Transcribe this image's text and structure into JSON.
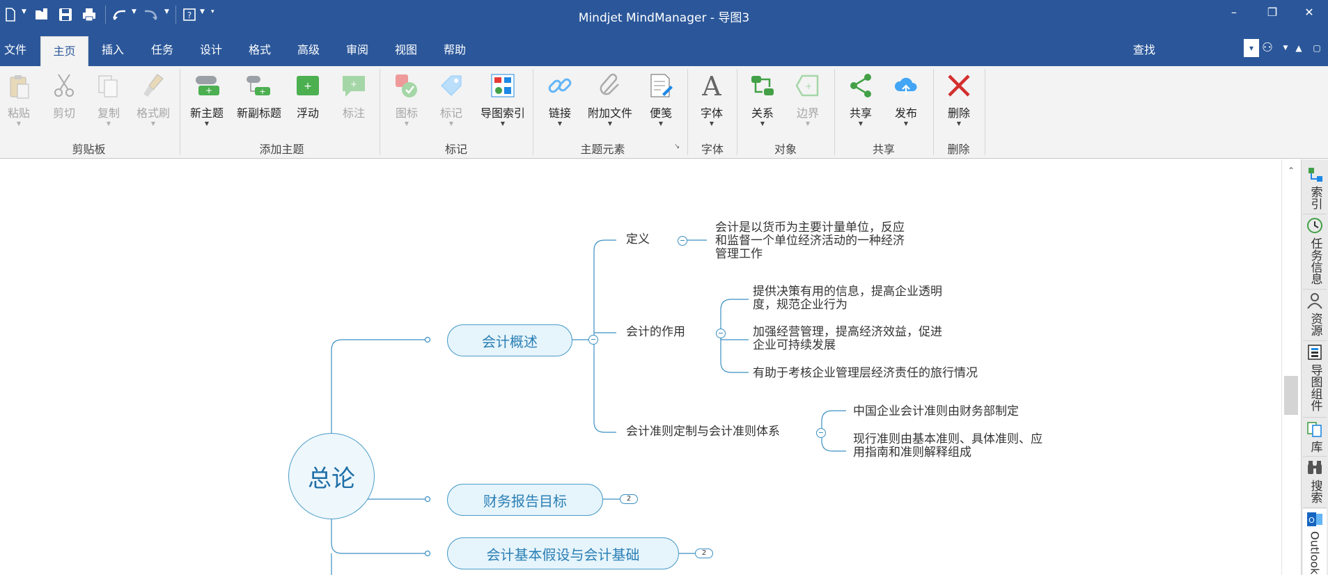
{
  "window": {
    "title": "Mindjet MindManager - 导图3",
    "controls": {
      "minimize": "–",
      "restore": "❐",
      "close": "✕"
    }
  },
  "quick_access": [
    "new-doc-icon",
    "open-icon",
    "save-icon",
    "print-icon",
    "undo-icon",
    "redo-icon",
    "help-icon",
    "customize-icon"
  ],
  "tabs": [
    {
      "label": "文件"
    },
    {
      "label": "主页",
      "active": true
    },
    {
      "label": "插入"
    },
    {
      "label": "任务"
    },
    {
      "label": "设计"
    },
    {
      "label": "格式"
    },
    {
      "label": "高级"
    },
    {
      "label": "审阅"
    },
    {
      "label": "视图"
    },
    {
      "label": "帮助"
    }
  ],
  "search": {
    "label": "查找"
  },
  "ribbon": {
    "groups": [
      {
        "label": "剪贴板",
        "buttons": [
          {
            "label": "粘贴",
            "icon": "paste-icon",
            "enabled": false
          },
          {
            "label": "剪切",
            "icon": "scissors-icon",
            "enabled": false
          },
          {
            "label": "复制",
            "icon": "copy-icon",
            "enabled": false
          },
          {
            "label": "格式刷",
            "icon": "format-brush-icon",
            "enabled": false
          }
        ]
      },
      {
        "label": "添加主题",
        "buttons": [
          {
            "label": "新主题",
            "icon": "new-topic-icon",
            "enabled": true
          },
          {
            "label": "新副标题",
            "icon": "new-subtopic-icon",
            "enabled": true
          },
          {
            "label": "浮动",
            "icon": "floating-topic-icon",
            "enabled": true
          },
          {
            "label": "标注",
            "icon": "callout-icon",
            "enabled": false
          }
        ]
      },
      {
        "label": "标记",
        "buttons": [
          {
            "label": "图标",
            "icon": "icons-icon",
            "enabled": false
          },
          {
            "label": "标记",
            "icon": "tag-icon",
            "enabled": false
          },
          {
            "label": "导图索引",
            "icon": "map-index-icon",
            "enabled": true
          }
        ]
      },
      {
        "label": "主题元素",
        "buttons": [
          {
            "label": "链接",
            "icon": "link-icon",
            "enabled": true
          },
          {
            "label": "附加文件",
            "icon": "paperclip-icon",
            "enabled": true
          },
          {
            "label": "便笺",
            "icon": "notes-icon",
            "enabled": true
          }
        ]
      },
      {
        "label": "字体",
        "buttons": [
          {
            "label": "字体",
            "icon": "font-icon",
            "enabled": true
          }
        ]
      },
      {
        "label": "对象",
        "buttons": [
          {
            "label": "关系",
            "icon": "relationship-icon",
            "enabled": true
          },
          {
            "label": "边界",
            "icon": "boundary-icon",
            "enabled": false
          }
        ]
      },
      {
        "label": "共享",
        "buttons": [
          {
            "label": "共享",
            "icon": "share-icon",
            "enabled": true
          },
          {
            "label": "发布",
            "icon": "cloud-publish-icon",
            "enabled": true
          }
        ]
      },
      {
        "label": "删除",
        "buttons": [
          {
            "label": "删除",
            "icon": "delete-x-icon",
            "enabled": true
          }
        ]
      }
    ]
  },
  "side_panel": [
    {
      "label": "索引",
      "icon": "index-icon"
    },
    {
      "label": "任务信息",
      "icon": "task-info-icon"
    },
    {
      "label": "资源",
      "icon": "resource-person-icon"
    },
    {
      "label": "导图组件",
      "icon": "map-parts-icon"
    },
    {
      "label": "库",
      "icon": "library-icon"
    },
    {
      "label": "搜索",
      "icon": "binoculars-icon"
    },
    {
      "label": "Outlook",
      "icon": "outlook-icon"
    }
  ],
  "mindmap": {
    "central": "总论",
    "topics": [
      {
        "label": "会计概述",
        "subtopics": [
          {
            "label": "定义",
            "children": [
              "会计是以货币为主要计量单位，反应\n和监督一个单位经济活动的一种经济\n管理工作"
            ]
          },
          {
            "label": "会计的作用",
            "children": [
              "提供决策有用的信息，提高企业透明\n度，规范企业行为",
              "加强经营管理，提高经济效益，促进\n企业可持续发展",
              "有助于考核企业管理层经济责任的旅行情况"
            ]
          },
          {
            "label": "会计准则定制与会计准则体系",
            "children": [
              "中国企业会计准则由财务部制定",
              "现行准则由基本准则、具体准则、应\n用指南和准则解释组成"
            ]
          }
        ]
      },
      {
        "label": "财务报告目标",
        "collapsed_count": "2"
      },
      {
        "label": "会计基本假设与会计基础",
        "collapsed_count": "2"
      }
    ]
  },
  "colors": {
    "titlebar": "#2b579a",
    "ribbon": "#f3f3f3",
    "topic_border": "#4a9cc8",
    "topic_fill": "#e6f4fb",
    "topic_text": "#2a7fb5",
    "delete_red": "#d32f2f"
  }
}
